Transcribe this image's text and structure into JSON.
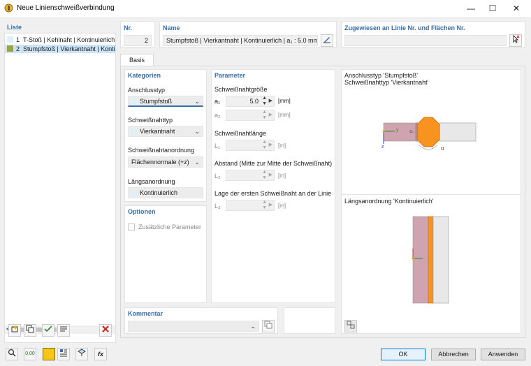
{
  "window": {
    "title": "Neue Linienschweißverbindung"
  },
  "list": {
    "header": "Liste",
    "items": [
      {
        "num": "1",
        "label": "T-Stoß | Kehlnaht | Kontinuierlich",
        "color": "#dff1f8"
      },
      {
        "num": "2",
        "label": "Stumpfstoß | Vierkantnaht | Kontinuierlich",
        "color": "#9aa34a"
      }
    ]
  },
  "nr": {
    "label": "Nr.",
    "value": "2"
  },
  "name": {
    "label": "Name",
    "value": "Stumpfstoß | Vierkantnaht | Kontinuierlich | a₁ : 5.0 mm"
  },
  "assigned": {
    "label": "Zugewiesen an Linie Nr. und Flächen Nr.",
    "value": ""
  },
  "tabs": {
    "basis": "Basis"
  },
  "kategorien": {
    "header": "Kategorien",
    "anschluss_label": "Anschlusstyp",
    "anschluss_value": "Stumpfstoß",
    "naht_label": "Schweißnahttyp",
    "naht_value": "Vierkantnaht",
    "anordnung_label": "Schweißnahtanordnung",
    "anordnung_value": "Flächennormale (+z)",
    "laengs_label": "Längsanordnung",
    "laengs_value": "Kontinuierlich"
  },
  "optionen": {
    "header": "Optionen",
    "zusatz_label": "Zusätzliche Parameter"
  },
  "parameter": {
    "header": "Parameter",
    "groesse_label": "Schweißnahtgröße",
    "a1_label": "a₁",
    "a1_value": "5.0",
    "a1_unit": "[mm]",
    "a2_label": "a₂",
    "a2_unit": "[mm]",
    "laenge_label": "Schweißnahtlänge",
    "l1_label": "L₁",
    "l1_unit": "[m]",
    "abstand_label": "Abstand (Mitte zur Mitte der Schweißnaht)",
    "l2_label": "L₂",
    "l2_unit": "[m]",
    "lage_label": "Lage der ersten Schweißnaht an der Linie",
    "l3_label": "L₃",
    "l3_unit": "[m]"
  },
  "preview": {
    "line1": "Anschlusstyp 'Stumpfstoß'",
    "line2": "Schweißnahttyp 'Vierkantnaht'",
    "line3": "Längsanordnung 'Kontinuierlich'",
    "axis_y": "y",
    "axis_z": "z",
    "dim_a": "a₁",
    "angle": "α",
    "colors": {
      "plate1": "#cfa4b0",
      "plate2": "#e8e8e8",
      "weld": "#f7931e"
    }
  },
  "kommentar": {
    "label": "Kommentar",
    "value": ""
  },
  "footer": {
    "ok": "OK",
    "abbrechen": "Abbrechen",
    "anwenden": "Anwenden",
    "tool_units": "0,00",
    "tool_fx": "fx"
  },
  "icons": {
    "new": "new-item-icon",
    "copy": "copy-icon",
    "check": "check-all-icon",
    "uncheck": "uncheck-icon",
    "delete": "delete-icon"
  }
}
